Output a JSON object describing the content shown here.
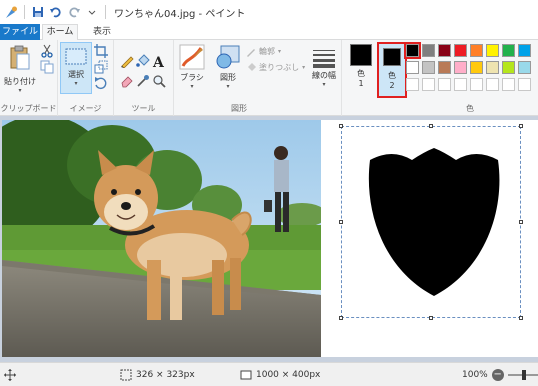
{
  "window": {
    "title": "ワンちゃん04.jpg - ペイント"
  },
  "tabs": {
    "file": "ファイル",
    "home": "ホーム",
    "view": "表示"
  },
  "ribbon": {
    "clipboard": {
      "paste": "貼り付け",
      "group_label": "クリップボード"
    },
    "image": {
      "select": "選択",
      "group_label": "イメージ"
    },
    "tools": {
      "group_label": "ツール"
    },
    "shapes": {
      "brush": "ブラシ",
      "shapes": "図形",
      "outline": "輪郭",
      "fill": "塗りつぶし",
      "group_label": "図形"
    },
    "size": {
      "label": "線の幅"
    },
    "colors": {
      "color1_label": "色",
      "color1_num": "1",
      "color2_label": "色",
      "color2_num": "2",
      "group_label": "色",
      "palette_row1": [
        "#000000",
        "#7f7f7f",
        "#880015",
        "#ed1c24",
        "#ff7f27",
        "#fff200",
        "#22b14c",
        "#00a2e8"
      ],
      "palette_row2": [
        "#ffffff",
        "#c3c3c3",
        "#b97a57",
        "#ffaec9",
        "#ffc90e",
        "#efe4b0",
        "#b5e61d",
        "#99d9ea"
      ]
    }
  },
  "status": {
    "selection_size": "326 × 323px",
    "image_size": "1000 × 400px",
    "zoom": "100%"
  }
}
